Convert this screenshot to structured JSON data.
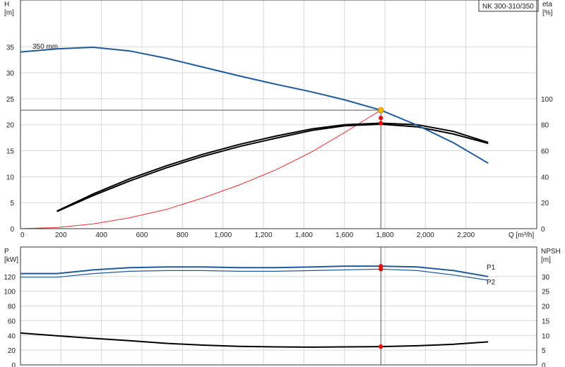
{
  "chart_data": {
    "model_label": "NK 300-310/350",
    "x_axis": {
      "label": "Q [m³/h]",
      "min": 0,
      "max": 2550,
      "ticks": [
        0,
        200,
        400,
        600,
        800,
        1000,
        1200,
        1400,
        1600,
        1800,
        2000,
        2200
      ],
      "tick_labels": [
        "0",
        "200",
        "400",
        "600",
        "800",
        "1,000",
        "1,200",
        "1,400",
        "1,600",
        "1,800",
        "2,000",
        "2,200"
      ]
    },
    "top": {
      "left_axis": {
        "title": "H",
        "unit": "[m]",
        "min": 0,
        "max": 44,
        "ticks": [
          0,
          5,
          10,
          15,
          20,
          25,
          30,
          35
        ]
      },
      "right_axis": {
        "title": "eta",
        "unit": "[%]",
        "min": 0,
        "max": 176,
        "ticks": [
          0,
          20,
          40,
          60,
          80,
          100
        ]
      },
      "impeller_label": "350 mm",
      "head_curve": [
        [
          0,
          34.0
        ],
        [
          180,
          34.6
        ],
        [
          360,
          34.9
        ],
        [
          540,
          34.2
        ],
        [
          720,
          32.8
        ],
        [
          900,
          31.1
        ],
        [
          1080,
          29.4
        ],
        [
          1260,
          27.8
        ],
        [
          1440,
          26.3
        ],
        [
          1600,
          24.8
        ],
        [
          1780,
          22.8
        ],
        [
          1960,
          19.9
        ],
        [
          2140,
          16.5
        ],
        [
          2310,
          12.6
        ]
      ],
      "eta_curves": [
        {
          "values": [
            [
              180,
              13.6
            ],
            [
              360,
              26.8
            ],
            [
              540,
              38.4
            ],
            [
              720,
              48.4
            ],
            [
              900,
              57.2
            ],
            [
              1080,
              64.8
            ],
            [
              1260,
              71.2
            ],
            [
              1440,
              76.8
            ],
            [
              1600,
              80.0
            ],
            [
              1780,
              81.2
            ],
            [
              1960,
              80.0
            ],
            [
              2140,
              74.8
            ],
            [
              2310,
              66.4
            ]
          ]
        },
        {
          "values": [
            [
              180,
              13.2
            ],
            [
              360,
              25.6
            ],
            [
              540,
              36.8
            ],
            [
              720,
              46.8
            ],
            [
              900,
              55.6
            ],
            [
              1080,
              63.2
            ],
            [
              1260,
              69.6
            ],
            [
              1440,
              75.6
            ],
            [
              1600,
              79.2
            ],
            [
              1780,
              80.4
            ],
            [
              1960,
              78.4
            ],
            [
              2140,
              72.8
            ],
            [
              2310,
              65.6
            ]
          ]
        }
      ],
      "system_curve": [
        [
          0,
          0.0
        ],
        [
          180,
          0.22
        ],
        [
          360,
          0.92
        ],
        [
          540,
          2.1
        ],
        [
          720,
          3.7
        ],
        [
          900,
          5.9
        ],
        [
          1080,
          8.4
        ],
        [
          1260,
          11.3
        ],
        [
          1440,
          14.8
        ],
        [
          1600,
          18.5
        ],
        [
          1780,
          22.8
        ]
      ],
      "duty_point": {
        "q": 1780,
        "h": 22.8
      },
      "eta_points": [
        85.2,
        81.2
      ]
    },
    "bottom": {
      "left_axis": {
        "title": "P",
        "unit": "[kW]",
        "min": 0,
        "max": 160,
        "ticks": [
          0,
          20,
          40,
          60,
          80,
          100,
          120
        ]
      },
      "right_axis": {
        "title": "NPSH",
        "unit": "[m]",
        "min": 0,
        "max": 40,
        "ticks": [
          0,
          5,
          10,
          15,
          20,
          25,
          30
        ]
      },
      "p1": {
        "name": "P1",
        "values": [
          [
            0,
            124
          ],
          [
            180,
            124
          ],
          [
            360,
            129
          ],
          [
            540,
            132
          ],
          [
            720,
            133
          ],
          [
            900,
            133
          ],
          [
            1080,
            132
          ],
          [
            1260,
            132
          ],
          [
            1440,
            133
          ],
          [
            1600,
            134
          ],
          [
            1780,
            134
          ],
          [
            1960,
            133
          ],
          [
            2140,
            128
          ],
          [
            2310,
            120
          ]
        ]
      },
      "p2": {
        "name": "P2",
        "values": [
          [
            0,
            119
          ],
          [
            180,
            119
          ],
          [
            360,
            124
          ],
          [
            540,
            127
          ],
          [
            720,
            128
          ],
          [
            900,
            128
          ],
          [
            1080,
            127
          ],
          [
            1260,
            127
          ],
          [
            1440,
            128
          ],
          [
            1600,
            129
          ],
          [
            1780,
            130
          ],
          [
            1960,
            128
          ],
          [
            2140,
            122
          ],
          [
            2310,
            115
          ]
        ]
      },
      "npsh": {
        "values": [
          [
            0,
            10.8
          ],
          [
            180,
            9.9
          ],
          [
            360,
            9.0
          ],
          [
            540,
            8.2
          ],
          [
            720,
            7.3
          ],
          [
            900,
            6.7
          ],
          [
            1080,
            6.3
          ],
          [
            1260,
            6.1
          ],
          [
            1440,
            6.0
          ],
          [
            1600,
            6.1
          ],
          [
            1780,
            6.2
          ],
          [
            1960,
            6.5
          ],
          [
            2140,
            7.0
          ],
          [
            2310,
            7.8
          ]
        ]
      },
      "duty_points": {
        "p1": 134,
        "p2": 130,
        "npsh": 6.2
      }
    },
    "colors": {
      "head": "#1f5a99",
      "eta": "#000000",
      "system": "#e83030",
      "power": "#1f5a99",
      "npsh": "#000000",
      "duty_point": "#f2b705",
      "marker": "#e01010"
    }
  }
}
